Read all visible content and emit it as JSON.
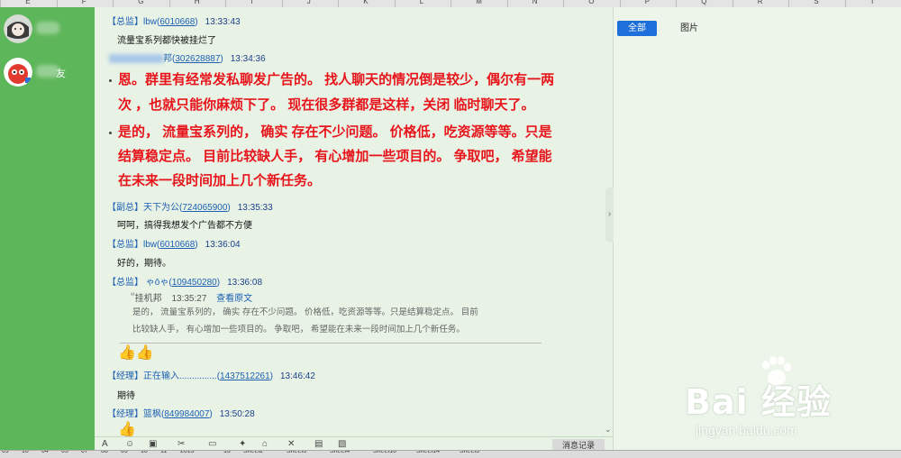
{
  "columns": [
    "E",
    "F",
    "G",
    "H",
    "I",
    "J",
    "K",
    "L",
    "M",
    "N",
    "O",
    "P",
    "Q",
    "R",
    "S",
    "T"
  ],
  "contacts": [
    {
      "name": "",
      "avatar_color": "#9aa29a"
    },
    {
      "name": "友",
      "avatar_color": "#e23a2f"
    }
  ],
  "messages": [
    {
      "role": "【总监】",
      "user": "lbw",
      "uid": "6010668",
      "time": "13:33:43",
      "text": "流量宝系列都快被挂烂了"
    },
    {
      "role": "",
      "user": "邦",
      "uid": "302628887",
      "time": "13:34:36"
    },
    {
      "role": "【副总】",
      "user": "天下为公",
      "uid": "724065900",
      "time": "13:35:33",
      "text": "呵呵，搞得我想发个广告都不方便"
    },
    {
      "role": "【总监】",
      "user": "lbw",
      "uid": "6010668",
      "time": "13:36:04",
      "text": "好的，期待。"
    },
    {
      "role": "【总监】",
      "user": "ゃōゃ",
      "uid": "109450280",
      "time": "13:36:08"
    },
    {
      "role": "【经理】",
      "user": "正在输入...............",
      "uid": "1437512261",
      "time": "13:46:42",
      "text": "期待"
    },
    {
      "role": "【经理】",
      "user": "篮枫",
      "uid": "849984007",
      "time": "13:50:28"
    }
  ],
  "big_reply": {
    "line1": "恩。群里有经常发私聊发广告的。 找人聊天的情况倒是较少，偶尔有一两",
    "line2": "次 ，也就只能你麻烦下了。 现在很多群都是这样，关闭 临时聊天了。",
    "line3": "是的， 流量宝系列的， 确实 存在不少问题。 价格低，吃资源等等。只是",
    "line4": "结算稳定点。 目前比较缺人手， 有心增加一些项目的。 争取吧， 希望能",
    "line5": "在未来一段时间加上几个新任务。"
  },
  "quote": {
    "mark": "“",
    "author": "挂机邦",
    "time": "13:35:27",
    "link": "查看原文",
    "line1": "是的， 流量宝系列的， 确实 存在不少问题。 价格低，吃资源等等。只是结算稳定点。 目前",
    "line2": "比较缺人手， 有心增加一些项目的。 争取吧， 希望能在未来一段时间加上几个新任务。"
  },
  "right_tabs": {
    "all": "全部",
    "images": "图片"
  },
  "toolbar": {
    "history": "消息记录"
  },
  "watermark": {
    "brand": "Bai 经验",
    "url": "jingyan.baidu.com"
  },
  "sheets": [
    "09",
    "10",
    "04",
    "05",
    "07",
    "08",
    "09",
    "10",
    "11",
    "2015",
    "13",
    "Sheet2",
    "Sheet3",
    "Sheet4",
    "Sheet10",
    "Sheet14",
    "Sheet5"
  ],
  "colors": {
    "accent": "#1e6fd9",
    "green": "#5eb65a",
    "red_text": "#e8141b",
    "link": "#1c5fb3"
  }
}
